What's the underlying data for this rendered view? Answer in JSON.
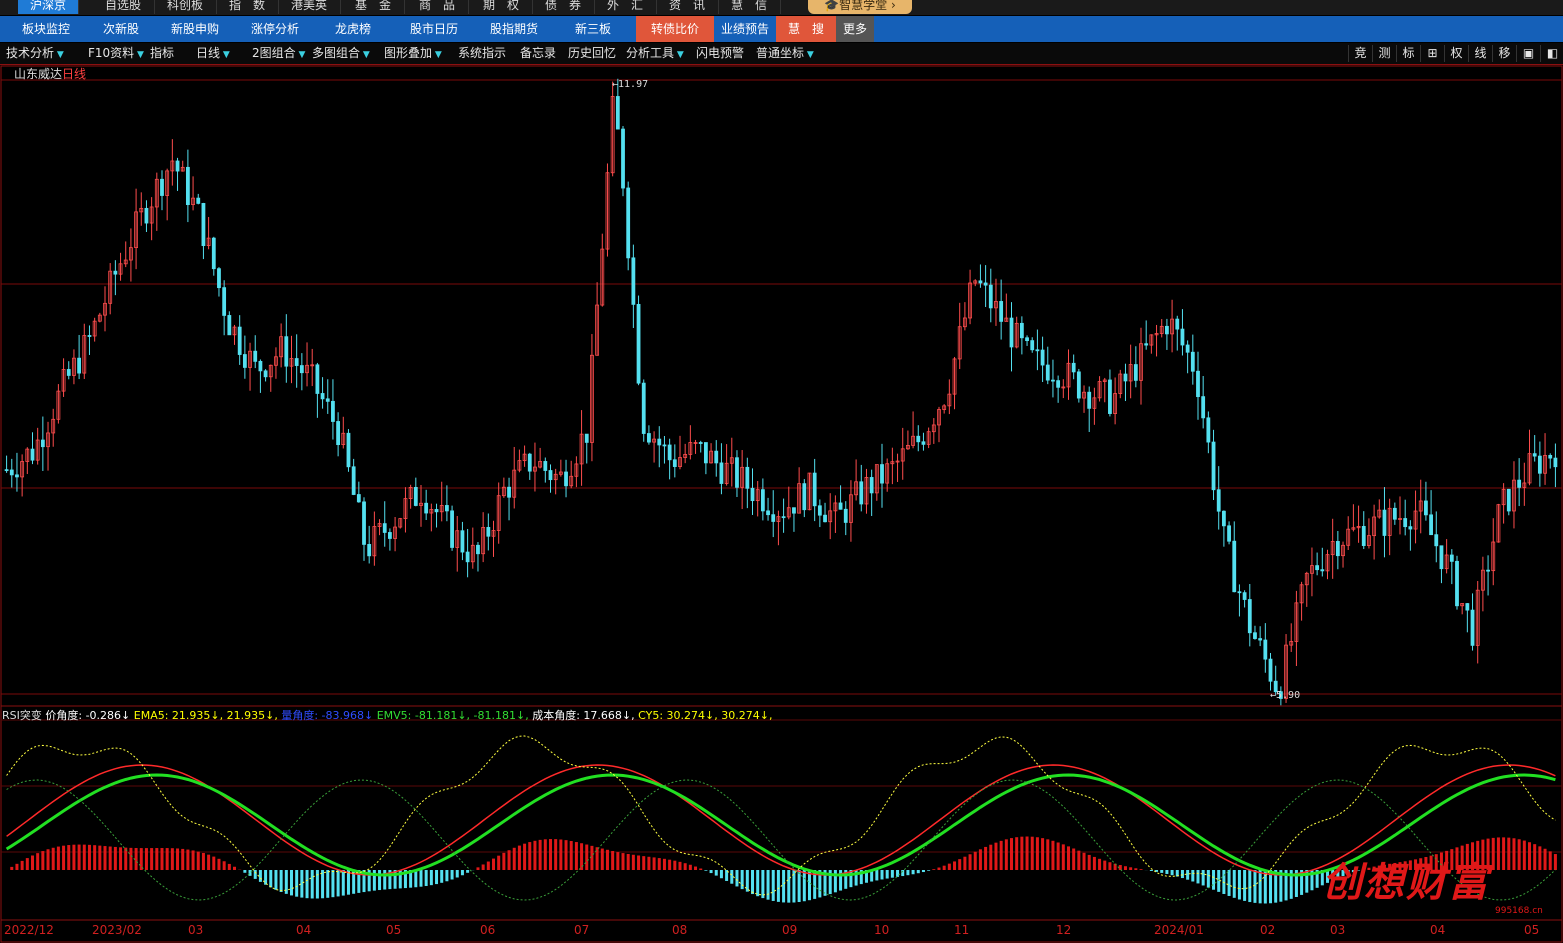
{
  "top_tabs": [
    {
      "label": "沪深京",
      "active": true
    },
    {
      "label": "自选股"
    },
    {
      "label": "科创板"
    },
    {
      "label": "指　数"
    },
    {
      "label": "港美英"
    },
    {
      "label": "基　金"
    },
    {
      "label": "商　品"
    },
    {
      "label": "期　权"
    },
    {
      "label": "债　券"
    },
    {
      "label": "外　汇"
    },
    {
      "label": "资　讯"
    },
    {
      "label": "慧　信"
    }
  ],
  "brand_label": "智慧学堂",
  "nav_tabs": [
    {
      "label": "板块监控"
    },
    {
      "label": "次新股"
    },
    {
      "label": "新股申购"
    },
    {
      "label": "涨停分析"
    },
    {
      "label": "龙虎榜"
    },
    {
      "label": "股市日历"
    },
    {
      "label": "股指期货"
    },
    {
      "label": "新三板"
    },
    {
      "label": "转债比价",
      "hl": true
    },
    {
      "label": "业绩预告"
    },
    {
      "label": "慧　搜",
      "hl": true
    },
    {
      "label": "更多",
      "more": true
    }
  ],
  "toolbar": [
    "技术分析",
    "F10资料",
    "指标",
    "日线",
    "2图组合",
    "多图组合",
    "图形叠加",
    "系统指示",
    "备忘录",
    "历史回忆",
    "分析工具",
    "闪电预警",
    "普通坐标"
  ],
  "toolbar_right": [
    "竞",
    "测",
    "标",
    "⊞",
    "权",
    "线",
    "移",
    "▣",
    "◧"
  ],
  "stock_name": "山东威达",
  "timeframe": "日线",
  "high_label": "11.97",
  "low_label": "5.90",
  "indicator": {
    "name": "RSI突变",
    "items": [
      {
        "text": "价角度: -0.286↓",
        "color": "#ffffff"
      },
      {
        "text": "EMA5: 21.935↓, 21.935↓,",
        "color": "#ffff00"
      },
      {
        "text": "量角度: -83.968↓",
        "color": "#2f4dff"
      },
      {
        "text": "EMV5: -81.181↓, -81.181↓,",
        "color": "#33dd33"
      },
      {
        "text": "成本角度: 17.668↓,",
        "color": "#ffffff"
      },
      {
        "text": "CY5: 30.274↓, 30.274↓,",
        "color": "#ffff00"
      }
    ]
  },
  "x_axis": [
    "2022/12",
    "2023/02",
    "03",
    "04",
    "05",
    "06",
    "07",
    "08",
    "09",
    "10",
    "11",
    "12",
    "2024/01",
    "02",
    "03",
    "04",
    "05"
  ],
  "watermark": "创想财富",
  "watermark_sub": "995168.cn",
  "chart_data": {
    "type": "candlestick",
    "title": "山东威达 日线",
    "max_price": 11.97,
    "min_price": 5.9,
    "close_trend": [
      8.1,
      8.3,
      8.9,
      9.4,
      10.1,
      10.7,
      11.2,
      10.6,
      9.6,
      9.1,
      9.3,
      9.0,
      8.5,
      7.3,
      7.6,
      7.9,
      7.5,
      7.2,
      7.9,
      8.2,
      8.0,
      8.5,
      11.97,
      8.6,
      8.2,
      8.3,
      8.1,
      7.9,
      7.7,
      7.9,
      7.6,
      7.9,
      8.1,
      8.4,
      8.9,
      10.0,
      9.6,
      9.2,
      9.1,
      8.9,
      8.8,
      9.2,
      9.6,
      9.1,
      7.4,
      6.5,
      5.9,
      7.0,
      7.4,
      7.5,
      7.6,
      7.7,
      7.2,
      6.5,
      7.7,
      8.1,
      8.3
    ]
  }
}
